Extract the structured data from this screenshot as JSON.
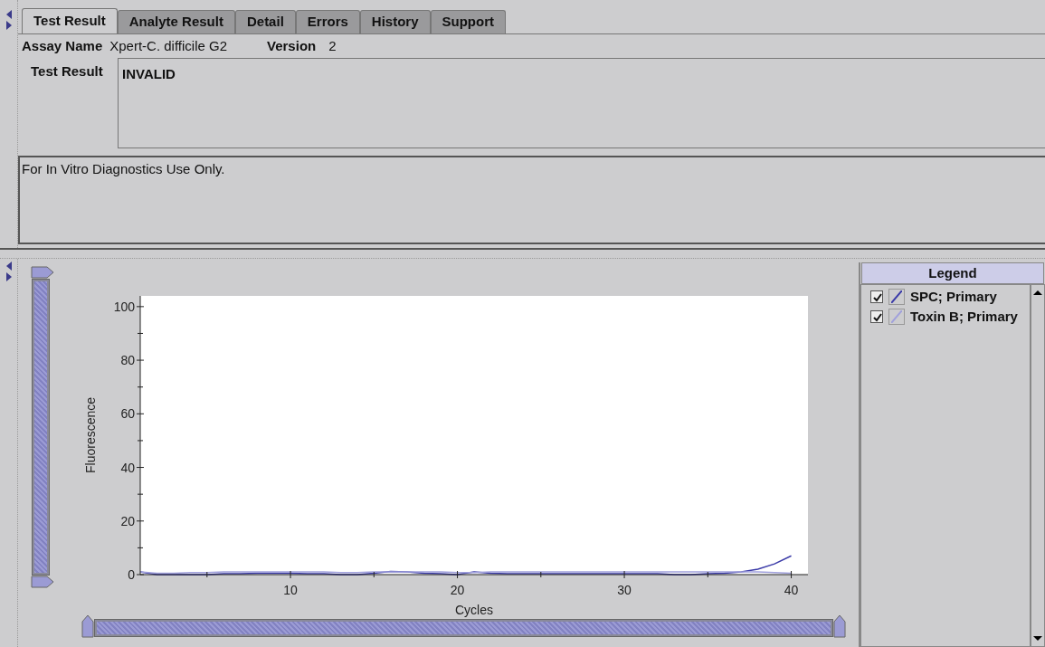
{
  "tabs": [
    {
      "label": "Test Result",
      "selected": true
    },
    {
      "label": "Analyte Result",
      "selected": false
    },
    {
      "label": "Detail",
      "selected": false
    },
    {
      "label": "Errors",
      "selected": false
    },
    {
      "label": "History",
      "selected": false
    },
    {
      "label": "Support",
      "selected": false
    }
  ],
  "assay": {
    "name_label": "Assay Name",
    "name": "Xpert-C. difficile G2",
    "version_label": "Version",
    "version": "2"
  },
  "test_result": {
    "label": "Test Result",
    "value": "INVALID"
  },
  "notice": "For In Vitro Diagnostics Use Only.",
  "chart": {
    "chart_data": {
      "type": "line",
      "xlabel": "Cycles",
      "ylabel": "Fluorescence",
      "xlim": [
        1,
        41
      ],
      "ylim": [
        0,
        104
      ],
      "xticks": [
        10,
        20,
        30,
        40
      ],
      "yticks": [
        0,
        20,
        40,
        60,
        80,
        100
      ],
      "x": [
        1,
        2,
        3,
        4,
        5,
        6,
        7,
        8,
        9,
        10,
        11,
        12,
        13,
        14,
        15,
        16,
        17,
        18,
        19,
        20,
        21,
        22,
        23,
        24,
        25,
        26,
        27,
        28,
        29,
        30,
        31,
        32,
        33,
        34,
        35,
        36,
        37,
        38,
        39,
        40
      ],
      "series": [
        {
          "name": "SPC; Primary",
          "color": "#3a3aa8",
          "values": [
            1,
            0,
            0,
            0,
            0,
            0.3,
            0.3,
            0.5,
            0.5,
            0.5,
            0.3,
            0.3,
            0,
            0,
            0.5,
            1.2,
            1,
            0.5,
            0.3,
            0,
            1,
            0.5,
            0.3,
            0.3,
            0.3,
            0.3,
            0.3,
            0.3,
            0.3,
            0.3,
            0.3,
            0.3,
            0,
            0,
            0.3,
            0.5,
            1,
            2,
            4,
            7
          ]
        },
        {
          "name": "Toxin B; Primary",
          "color": "#a0a0dc",
          "values": [
            1,
            0.5,
            0.5,
            0.8,
            0.8,
            1,
            1,
            1,
            1,
            1,
            1,
            1,
            0.8,
            0.8,
            1,
            1,
            1,
            1,
            1,
            0.8,
            0.8,
            1,
            1,
            1,
            1,
            1,
            1,
            1,
            1,
            1,
            1,
            1,
            1,
            1,
            1,
            1,
            1,
            1,
            0.8,
            0.5
          ]
        }
      ]
    }
  },
  "zoom": {
    "vertical": {
      "level": 1
    },
    "horizontal": {
      "level": 1
    }
  },
  "legend": {
    "title": "Legend",
    "items": [
      {
        "checked": true
      },
      {
        "checked": true
      }
    ]
  }
}
